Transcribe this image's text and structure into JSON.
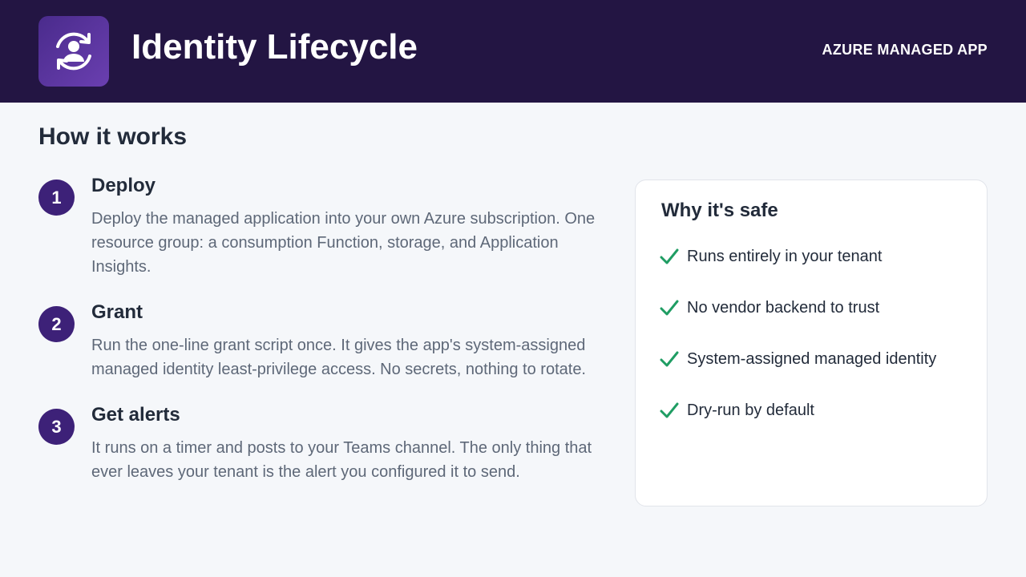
{
  "header": {
    "title": "Identity Lifecycle",
    "badge": "AZURE MANAGED APP",
    "logo_icon": "user-sync-icon",
    "background": "#231543",
    "accent": "#5a35a0"
  },
  "main": {
    "section_title": "How it works",
    "steps": [
      {
        "number": "1",
        "title": "Deploy",
        "description": "Deploy the managed application into your own Azure subscription. One resource group: a consumption Function, storage, and Application Insights."
      },
      {
        "number": "2",
        "title": "Grant",
        "description": "Run the one-line grant script once. It gives the app's system-assigned managed identity least-privilege access. No secrets, nothing to rotate."
      },
      {
        "number": "3",
        "title": "Get alerts",
        "description": "It runs on a timer and posts to your Teams channel. The only thing that ever leaves your tenant is the alert you configured it to send."
      }
    ]
  },
  "safety_card": {
    "title": "Why it's safe",
    "check_icon": "check-icon",
    "check_color": "#1f9d63",
    "items": [
      "Runs entirely in your tenant",
      "No vendor backend to trust",
      "System-assigned managed identity",
      "Dry-run by default"
    ]
  }
}
